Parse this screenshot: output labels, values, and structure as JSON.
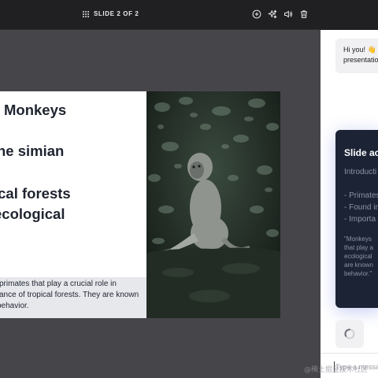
{
  "topbar": {
    "slide_indicator": "SLIDE 2 OF 2",
    "toolbar": {
      "add_icon": "plus-circle-icon",
      "ai_icon": "sparkles-icon",
      "audio_icon": "speaker-icon",
      "delete_icon": "trash-icon"
    }
  },
  "slide": {
    "lines": [
      "Monkeys",
      "he simian",
      "ical forests",
      "ecological"
    ],
    "description": [
      "primates that play a crucial role in",
      "ance of tropical forests. They are known",
      "behavior."
    ],
    "image": "monkey-photo"
  },
  "chat": {
    "greeting_lines": [
      "Hi you! 👋 I",
      "presentatio"
    ],
    "card": {
      "title": "Slide ac",
      "subtitle": "Introducti",
      "bullets": [
        "- Primates",
        "- Found in",
        "- Importa"
      ],
      "quote": [
        "\"Monkeys",
        "that play a",
        "ecological",
        "are known",
        "behavior.\""
      ]
    },
    "input_placeholder": "Type a messa"
  },
  "watermark": "@稀土掘金技术社区",
  "colors": {
    "topbar_bg": "#202022",
    "canvas_bg": "#46464a",
    "card_bg": "#1c2335",
    "card_glow": "#5a6edc"
  }
}
